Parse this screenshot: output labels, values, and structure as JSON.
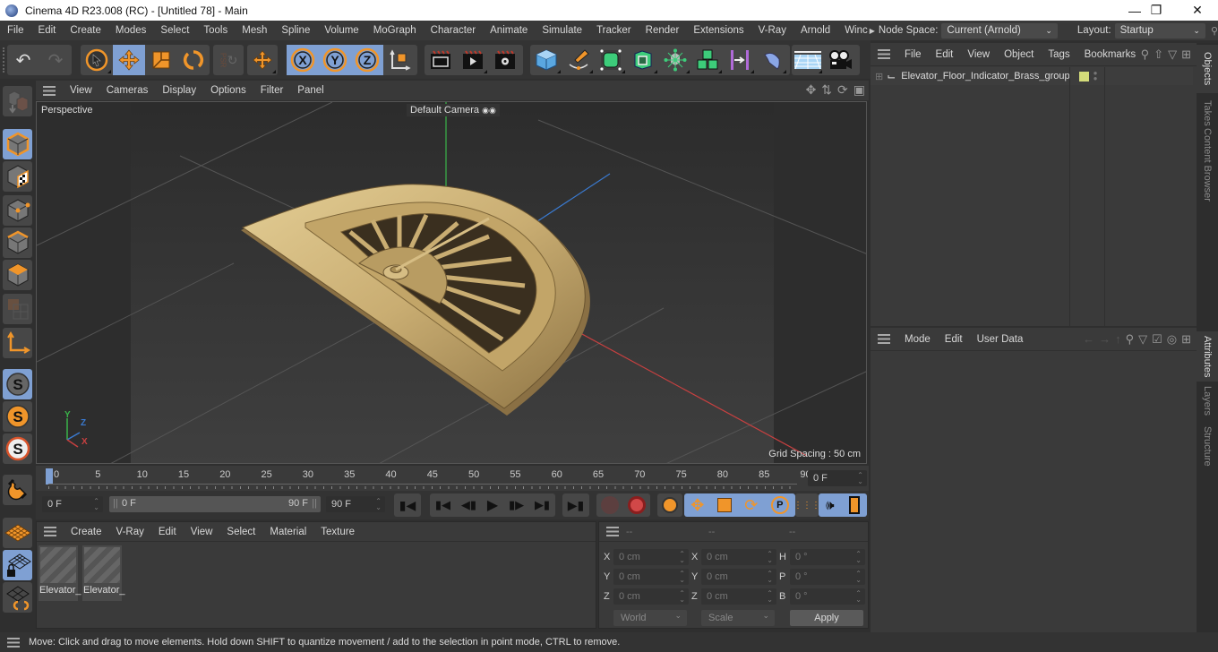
{
  "window": {
    "title": "Cinema 4D R23.008 (RC) - [Untitled 78] - Main",
    "controls": [
      "minimize",
      "restore",
      "close"
    ]
  },
  "menubar": {
    "items": [
      "File",
      "Edit",
      "Create",
      "Modes",
      "Select",
      "Tools",
      "Mesh",
      "Spline",
      "Volume",
      "MoGraph",
      "Character",
      "Animate",
      "Simulate",
      "Tracker",
      "Render",
      "Extensions",
      "V-Ray",
      "Arnold",
      "Winc"
    ],
    "node_space_label": "Node Space:",
    "node_space_value": "Current (Arnold)",
    "layout_label": "Layout:",
    "layout_value": "Startup"
  },
  "toolbar": {
    "groups": [
      {
        "name": "history",
        "items": [
          "undo-icon",
          "redo-icon"
        ]
      },
      {
        "name": "tools",
        "items": [
          "select-icon",
          "move-icon",
          "scale-icon",
          "rotate-icon"
        ]
      },
      {
        "name": "psr",
        "items": [
          "psr-icon"
        ]
      },
      {
        "name": "transform",
        "items": [
          "move-transform-icon"
        ]
      },
      {
        "name": "axis",
        "items": [
          "x-axis-icon",
          "y-axis-icon",
          "z-axis-icon",
          "coordinate-system-icon"
        ]
      },
      {
        "name": "render",
        "items": [
          "render-view-icon",
          "render-picture-viewer-icon",
          "render-settings-icon"
        ]
      },
      {
        "name": "objects",
        "items": [
          "cube-icon",
          "pen-icon",
          "subdivision-icon",
          "extrude-icon",
          "cloner-icon",
          "mograph-icon",
          "bend-deformer-icon",
          "nurbs-icon"
        ]
      },
      {
        "name": "scene",
        "items": [
          "floor-icon",
          "camera-icon"
        ]
      }
    ]
  },
  "left_toolbar": {
    "items": [
      "make-editable-icon",
      "model-mode-icon",
      "texture-mode-icon",
      "points-mode-icon",
      "edges-mode-icon",
      "polygons-mode-icon",
      "uv-mode-icon",
      "axis-mode-icon",
      "snap-icon",
      "snap-settings-icon",
      "workplane-snap-icon",
      "magnet-icon",
      "workplane-icon",
      "locked-workplane-icon",
      "workplane-align-icon"
    ]
  },
  "viewport": {
    "menu": [
      "View",
      "Cameras",
      "Display",
      "Options",
      "Filter",
      "Panel"
    ],
    "view_name": "Perspective",
    "camera": "Default Camera",
    "grid_spacing": "Grid Spacing : 50 cm",
    "axis_labels": {
      "x": "X",
      "y": "Y",
      "z": "Z"
    },
    "model": "Elevator floor indicator (brass)"
  },
  "timeline": {
    "ticks": [
      "0",
      "5",
      "10",
      "15",
      "20",
      "25",
      "30",
      "35",
      "40",
      "45",
      "50",
      "55",
      "60",
      "65",
      "70",
      "75",
      "80",
      "85",
      "90"
    ],
    "current_frame_field": "0 F",
    "start_field": "0 F",
    "range_start": "0 F",
    "range_end": "90 F",
    "end_field": "90 F"
  },
  "material_manager": {
    "menu": [
      "Create",
      "V-Ray",
      "Edit",
      "View",
      "Select",
      "Material",
      "Texture"
    ],
    "materials": [
      {
        "label": "Elevator_"
      },
      {
        "label": "Elevator_"
      }
    ]
  },
  "coordinates": {
    "headers": [
      "--",
      "--",
      "--"
    ],
    "rows": [
      {
        "l1": "X",
        "v1": "0 cm",
        "l2": "X",
        "v2": "0 cm",
        "l3": "H",
        "v3": "0 °"
      },
      {
        "l1": "Y",
        "v1": "0 cm",
        "l2": "Y",
        "v2": "0 cm",
        "l3": "P",
        "v3": "0 °"
      },
      {
        "l1": "Z",
        "v1": "0 cm",
        "l2": "Z",
        "v2": "0 cm",
        "l3": "B",
        "v3": "0 °"
      }
    ],
    "space": "World",
    "mode": "Scale",
    "apply": "Apply"
  },
  "object_manager": {
    "menu": [
      "File",
      "Edit",
      "View",
      "Object",
      "Tags",
      "Bookmarks"
    ],
    "objects": [
      {
        "name": "Elevator_Floor_Indicator_Brass_group",
        "color": "#d4dc7a"
      }
    ]
  },
  "attribute_manager": {
    "menu": [
      "Mode",
      "Edit",
      "User Data"
    ]
  },
  "side_tabs": {
    "top": [
      "Objects",
      "Takes",
      "Content Browser"
    ],
    "bottom": [
      "Attributes",
      "Layers",
      "Structure"
    ]
  },
  "status": {
    "text": "Move: Click and drag to move elements. Hold down SHIFT to quantize movement / add to the selection in point mode, CTRL to remove."
  },
  "colors": {
    "accent_selected": "#7fa0d3",
    "orange": "#f0952a",
    "green_axis": "#3ab54a",
    "red_axis": "#c84040",
    "blue_axis": "#3a7ad0",
    "brass": "#c9ad72"
  }
}
